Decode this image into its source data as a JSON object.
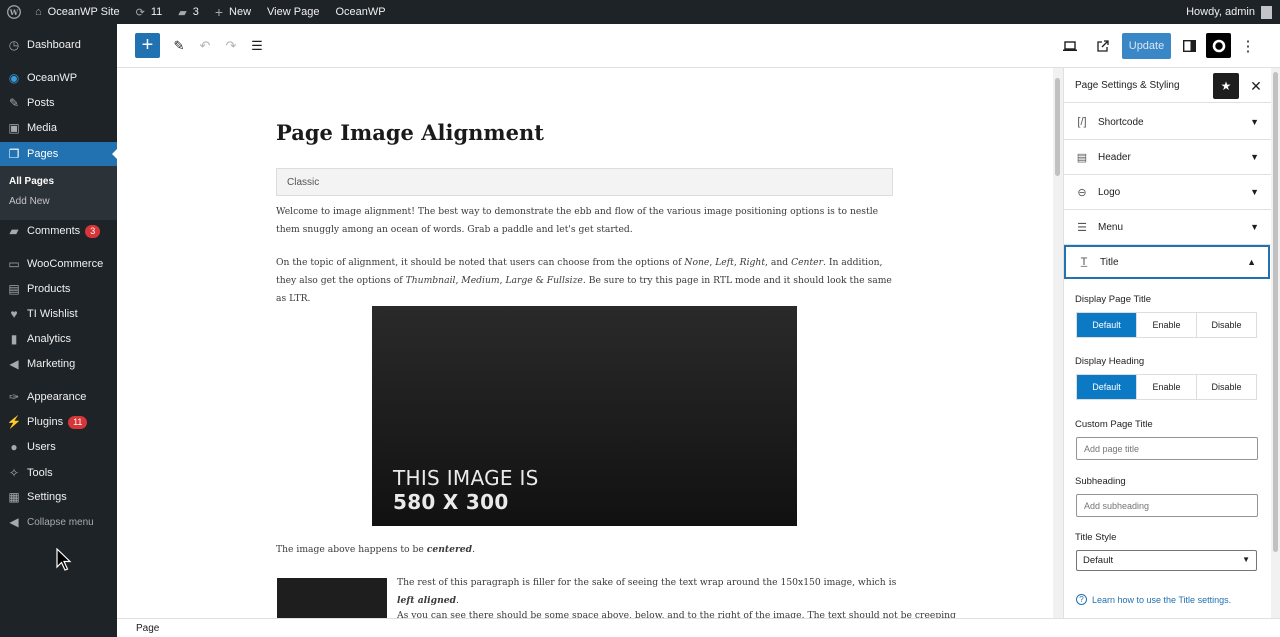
{
  "admin_bar": {
    "site_name": "OceanWP Site",
    "updates_count": "11",
    "comments_count": "3",
    "new_label": "New",
    "view_page_label": "View Page",
    "oceanwp_label": "OceanWP",
    "greeting": "Howdy, admin"
  },
  "menu": {
    "dashboard": "Dashboard",
    "oceanwp": "OceanWP",
    "posts": "Posts",
    "media": "Media",
    "pages": "Pages",
    "all_pages": "All Pages",
    "add_new": "Add New",
    "comments": "Comments",
    "comments_badge": "3",
    "woocommerce": "WooCommerce",
    "products": "Products",
    "ti_wishlist": "TI Wishlist",
    "analytics": "Analytics",
    "marketing": "Marketing",
    "appearance": "Appearance",
    "plugins": "Plugins",
    "plugins_badge": "11",
    "users": "Users",
    "tools": "Tools",
    "settings": "Settings",
    "collapse": "Collapse menu"
  },
  "toolbar": {
    "update_label": "Update"
  },
  "content": {
    "title": "Page Image Alignment",
    "classic_label": "Classic",
    "para1": "Welcome to image alignment! The best way to demonstrate the ebb and flow of the various image positioning options is to nestle them snuggly among an ocean of words. Grab a paddle and let's get started.",
    "para2_a": "On the topic of alignment, it should be noted that users can choose from the options of ",
    "para2_none": "None",
    "para2_left": "Left",
    "para2_right": "Right",
    "para2_center": "Center",
    "para2_b": ". In addition, they also get the options of ",
    "para2_thumb": "Thumbnail",
    "para2_medium": "Medium",
    "para2_large": "Large",
    "para2_full": "Fullsize",
    "para2_c": ". Be sure to try this page in RTL mode and it should look the same as LTR.",
    "image_line1": "THIS IMAGE IS",
    "image_line2": "580 X 300",
    "para3_a": "The image above happens to be ",
    "para3_b": "centered",
    "para4_a": "The rest of this paragraph is filler for the sake of seeing the text wrap around the 150x150 image, which is ",
    "para4_b": "left aligned",
    "para5": "As you can see there should be some space above, below, and to the right of the image. The text should not be creeping"
  },
  "footer": {
    "breadcrumb": "Page"
  },
  "sidebar": {
    "title": "Page Settings & Styling",
    "panels": {
      "shortcode": "Shortcode",
      "header": "Header",
      "logo": "Logo",
      "menu": "Menu",
      "title": "Title"
    },
    "display_page_title_label": "Display Page Title",
    "display_heading_label": "Display Heading",
    "options": {
      "default": "Default",
      "enable": "Enable",
      "disable": "Disable"
    },
    "display_page_title_selected": "Default",
    "display_heading_selected": "Default",
    "custom_page_title_label": "Custom Page Title",
    "custom_page_title_placeholder": "Add page title",
    "subheading_label": "Subheading",
    "subheading_placeholder": "Add subheading",
    "title_style_label": "Title Style",
    "title_style_value": "Default",
    "help_link": "Learn how to use the Title settings."
  },
  "colors": {
    "admin_dark": "#1d2327",
    "accent_blue": "#2271b1",
    "selected_segment": "#0b79c4",
    "badge_red": "#d63638"
  }
}
